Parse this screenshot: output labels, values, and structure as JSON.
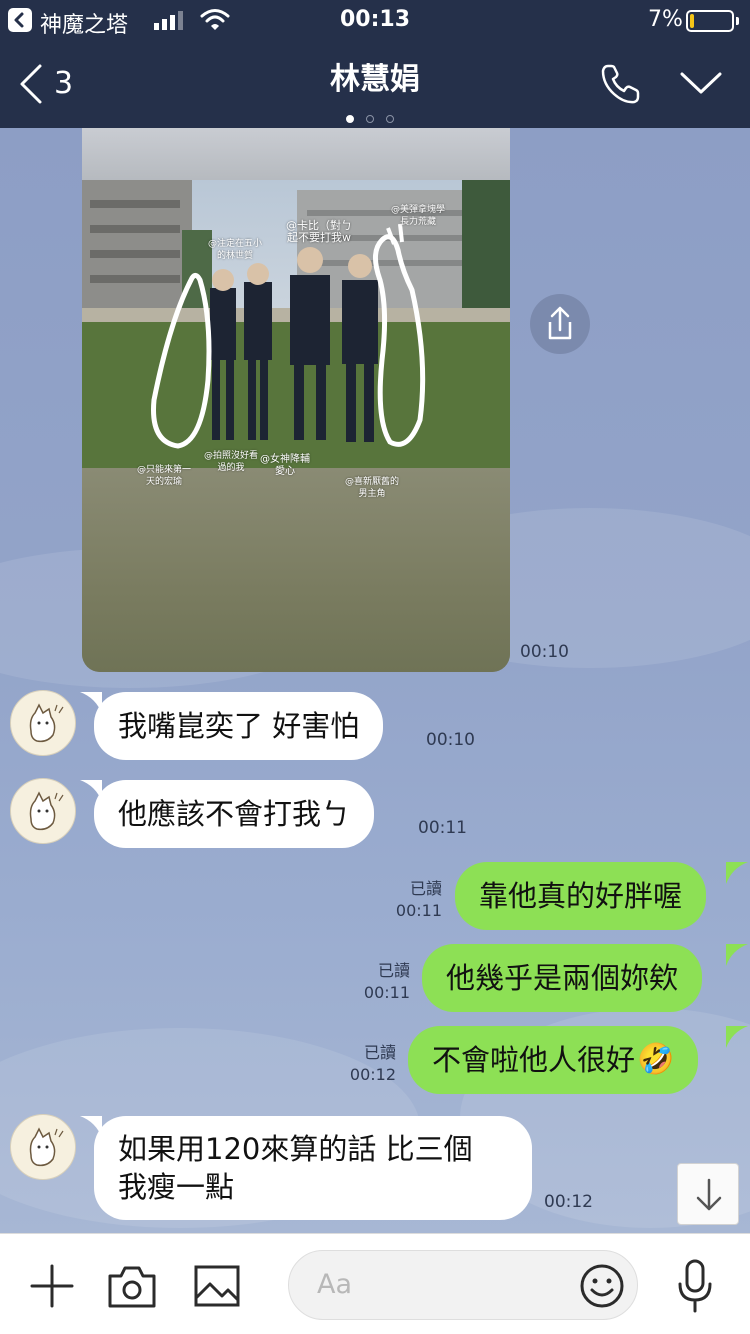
{
  "status_bar": {
    "app_name": "神魔之塔",
    "time": "00:13",
    "battery": "7%"
  },
  "header": {
    "back_count": "3",
    "title": "林慧娟",
    "page_dots": 3,
    "active_dot": 0
  },
  "photo": {
    "captions": [
      "@注定在五小\n的林世賀",
      "@卡比（對ㄅ\n起不要打我w",
      "@美彈拿塊學\n長力荒藏",
      "@拍照沒好看\n過的我",
      "@女神降輔\n愛心",
      "@只能來第一\n天的宏瑜",
      "@喜新厭舊的\n男主角"
    ],
    "time": "00:10"
  },
  "messages": [
    {
      "side": "left",
      "text": "我嘴崑奕了 好害怕",
      "time": "00:10"
    },
    {
      "side": "left",
      "text": "他應該不會打我ㄅ",
      "time": "00:11"
    },
    {
      "side": "right",
      "text": "靠他真的好胖喔",
      "read": "已讀",
      "time": "00:11"
    },
    {
      "side": "right",
      "text": "他幾乎是兩個妳欸",
      "read": "已讀",
      "time": "00:11"
    },
    {
      "side": "right",
      "text": "不會啦他人很好",
      "emoji": "🤣",
      "read": "已讀",
      "time": "00:12"
    },
    {
      "side": "left",
      "text_line1": "如果用120來算的話 比三個",
      "text_line2": "我瘦一點",
      "time": "00:12"
    }
  ],
  "input_bar": {
    "placeholder": "Aa",
    "icons": [
      "plus-icon",
      "camera-icon",
      "image-icon",
      "emoji-icon",
      "microphone-icon"
    ]
  },
  "colors": {
    "header_bg": "#25304a",
    "sent_bubble": "#8de055",
    "received_bubble": "#ffffff",
    "chat_bg": "#8e9fc6"
  }
}
